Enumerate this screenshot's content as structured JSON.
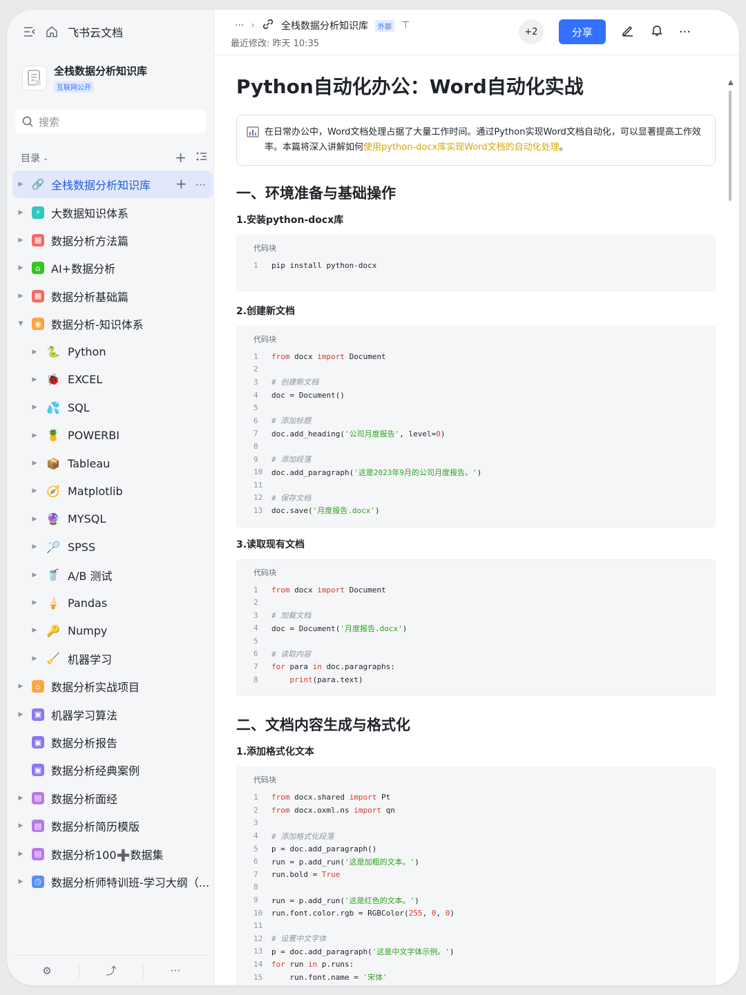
{
  "sidebar": {
    "app_title": "飞书云文档",
    "kb_name": "全栈数据分析知识库",
    "kb_badge": "互联网公开",
    "search_placeholder": "搜索",
    "toc_label": "目录",
    "items": [
      {
        "label": "全栈数据分析知识库",
        "color": "#3370ff",
        "glyph": "🔗",
        "level": 0,
        "active": true
      },
      {
        "label": "大数据知识体系",
        "color": "#2fc7c0",
        "glyph": "⚡",
        "level": 0
      },
      {
        "label": "数据分析方法篇",
        "color": "#f76964",
        "glyph": "▦",
        "level": 0
      },
      {
        "label": "AI+数据分析",
        "color": "#34c724",
        "glyph": "⌂",
        "level": 0
      },
      {
        "label": "数据分析基础篇",
        "color": "#f76964",
        "glyph": "▦",
        "level": 0
      },
      {
        "label": "数据分析-知识体系",
        "color": "#ffa53d",
        "glyph": "◉",
        "level": 0,
        "expanded": true
      },
      {
        "label": "Python",
        "glyph": "🐍",
        "level": 1
      },
      {
        "label": "EXCEL",
        "glyph": "🐞",
        "level": 1
      },
      {
        "label": "SQL",
        "glyph": "💦",
        "level": 1
      },
      {
        "label": "POWERBI",
        "glyph": "🍍",
        "level": 1
      },
      {
        "label": "Tableau",
        "glyph": "📦",
        "level": 1
      },
      {
        "label": "Matplotlib",
        "glyph": "🧭",
        "level": 1
      },
      {
        "label": "MYSQL",
        "glyph": "🔮",
        "level": 1
      },
      {
        "label": "SPSS",
        "glyph": "🏸",
        "level": 1
      },
      {
        "label": "A/B 测试",
        "glyph": "🥤",
        "level": 1
      },
      {
        "label": "Pandas",
        "glyph": "🍦",
        "level": 1
      },
      {
        "label": "Numpy",
        "glyph": "🔑",
        "level": 1
      },
      {
        "label": "机器学习",
        "glyph": "🧹",
        "level": 1
      },
      {
        "label": "数据分析实战项目",
        "color": "#ffa53d",
        "glyph": "⌂",
        "level": 0
      },
      {
        "label": "机器学习算法",
        "color": "#8b77f0",
        "glyph": "▣",
        "level": 0
      },
      {
        "label": "数据分析报告",
        "color": "#8b77f0",
        "glyph": "▣",
        "level": 0,
        "no_caret": true
      },
      {
        "label": "数据分析经典案例",
        "color": "#8b77f0",
        "glyph": "▣",
        "level": 0,
        "no_caret": true
      },
      {
        "label": "数据分析面经",
        "color": "#b57ae8",
        "glyph": "▤",
        "level": 0
      },
      {
        "label": "数据分析简历模版",
        "color": "#b57ae8",
        "glyph": "▤",
        "level": 0
      },
      {
        "label": "数据分析100➕数据集",
        "color": "#b57ae8",
        "glyph": "▤",
        "level": 0
      },
      {
        "label": "数据分析师特训班-学习大纲（...",
        "color": "#5b8ff9",
        "glyph": "◷",
        "level": 0
      }
    ]
  },
  "header": {
    "breadcrumb_more": "···",
    "kb_title": "全栈数据分析知识库",
    "external_badge": "外部",
    "modified": "最近修改: 昨天 10:35",
    "collaborators": "+2",
    "share_label": "分享"
  },
  "doc": {
    "title": "Python自动化办公：Word自动化实战",
    "callout_text": "在日常办公中，Word文档处理占据了大量工作时间。通过Python实现Word文档自动化，可以显著提高工作效率。本篇将深入讲解如何",
    "callout_highlight": "使用python-docx库实现Word文档的自动化处理",
    "callout_end": "。",
    "h2_1": "一、环境准备与基础操作",
    "h3_1": "1.安装python-docx库",
    "h3_2": "2.创建新文档",
    "h3_3": "3.读取现有文档",
    "h2_2": "二、文档内容生成与格式化",
    "h3_4": "1.添加格式化文本",
    "code_label": "代码块"
  }
}
